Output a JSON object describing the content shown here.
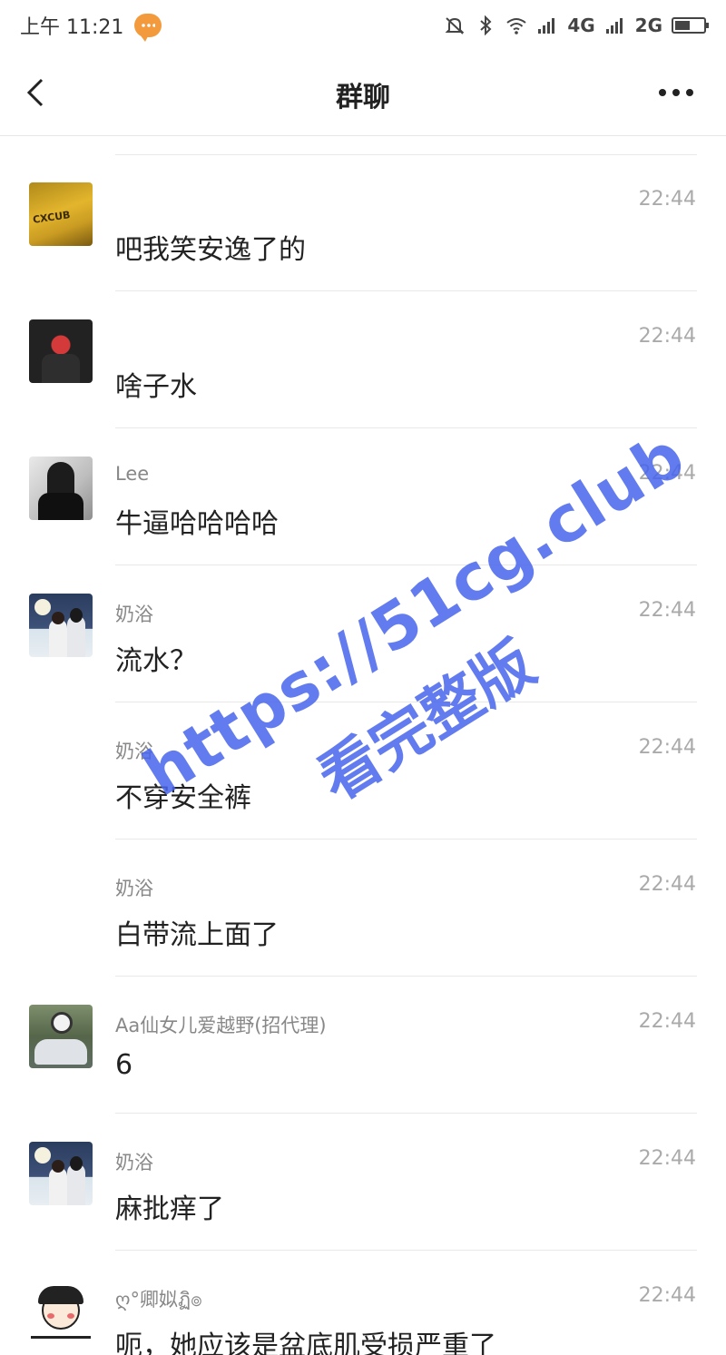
{
  "status_bar": {
    "time": "上午 11:21",
    "network_1": "4G",
    "network_2": "2G",
    "icons": [
      "notification-bubble-icon",
      "mute-icon",
      "bluetooth-icon",
      "wifi-icon",
      "signal-icon",
      "signal-icon",
      "battery-icon"
    ]
  },
  "header": {
    "title": "群聊",
    "back_icon": "back-arrow-icon",
    "more_icon": "more-dots-icon"
  },
  "messages": [
    {
      "sender": "",
      "time": "22:44",
      "text": "吧我笑安逸了的",
      "avatar": "yellow-sign"
    },
    {
      "sender": "",
      "time": "22:44",
      "text": "啥子水",
      "avatar": "dark-hero"
    },
    {
      "sender": "Lee",
      "time": "22:44",
      "text": "牛逼哈哈哈哈",
      "avatar": "girl-bw"
    },
    {
      "sender": "奶浴",
      "time": "22:44",
      "text": "流水？",
      "avatar": "couple-moon"
    },
    {
      "sender": "奶浴",
      "time": "22:44",
      "text": "不穿安全裤",
      "avatar": ""
    },
    {
      "sender": "奶浴",
      "time": "22:44",
      "text": "白带流上面了",
      "avatar": ""
    },
    {
      "sender": "Aa仙女儿爱越野(招代理)",
      "time": "22:44",
      "text": "6",
      "avatar": "moto-rider"
    },
    {
      "sender": "奶浴",
      "time": "22:44",
      "text": "麻批痒了",
      "avatar": "couple-moon"
    },
    {
      "sender": "ღ°卿姒ฏิ๏",
      "time": "22:44",
      "text": "呃，她应该是盆底肌受损严重了",
      "avatar": "cartoon-girl"
    }
  ],
  "watermark": {
    "url": "https://51cg.club",
    "subtitle": "看完整版",
    "color": "#4664eb"
  }
}
